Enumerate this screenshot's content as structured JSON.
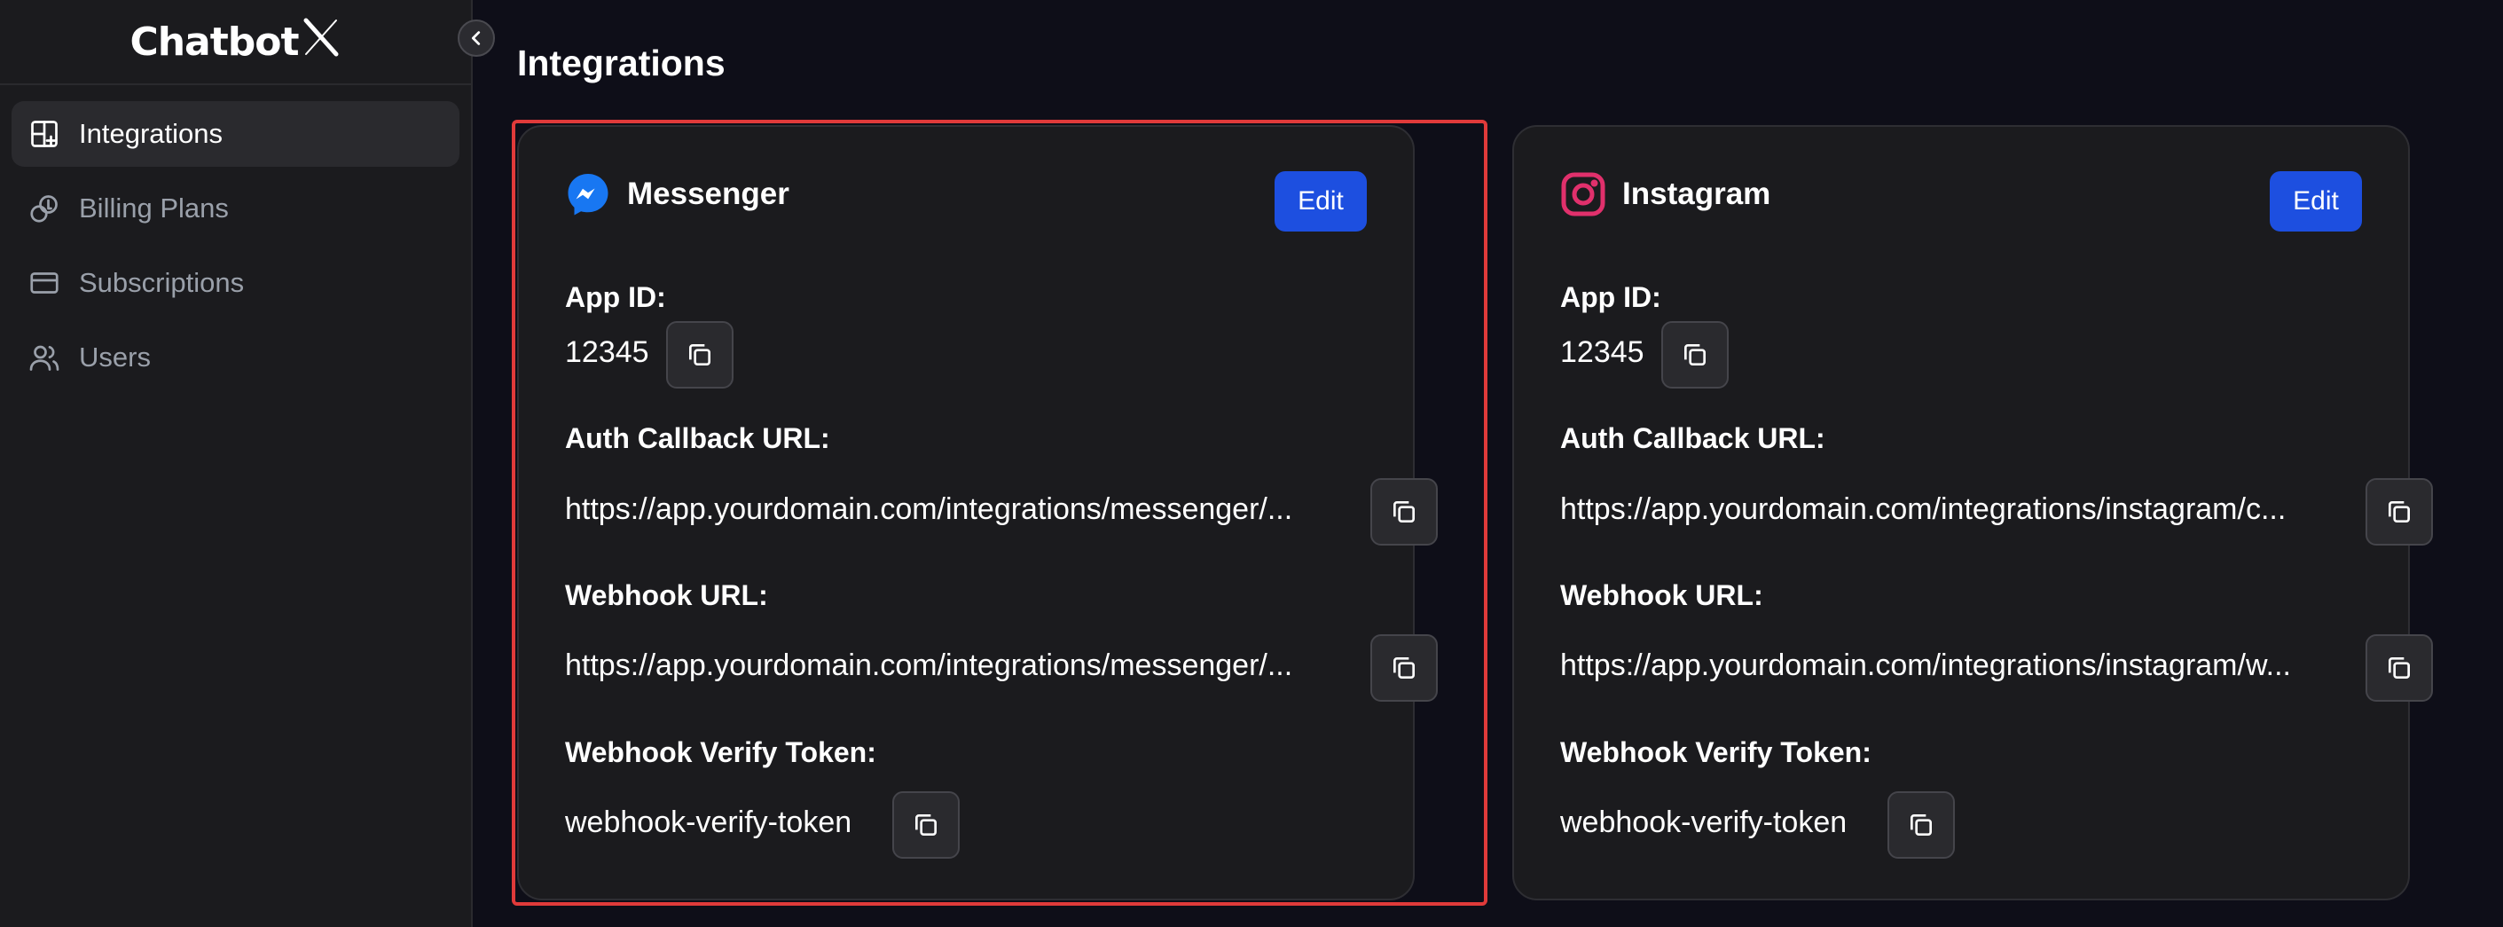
{
  "app": {
    "logo_text": "Chatbot",
    "logo_mark": "X"
  },
  "sidebar": {
    "items": [
      {
        "label": "Integrations",
        "icon": "integrations-grid-icon",
        "active": true
      },
      {
        "label": "Billing Plans",
        "icon": "billing-coins-icon",
        "active": false
      },
      {
        "label": "Subscriptions",
        "icon": "credit-card-icon",
        "active": false
      },
      {
        "label": "Users",
        "icon": "users-icon",
        "active": false
      }
    ]
  },
  "main": {
    "title": "Integrations"
  },
  "cards": {
    "messenger": {
      "name": "Messenger",
      "icon": "messenger-icon",
      "edit_label": "Edit",
      "app_id_label": "App ID:",
      "app_id": "12345",
      "auth_callback_label": "Auth Callback URL:",
      "auth_callback_url": "https://app.yourdomain.com/integrations/messenger/...",
      "webhook_label": "Webhook URL:",
      "webhook_url": "https://app.yourdomain.com/integrations/messenger/...",
      "verify_token_label": "Webhook Verify Token:",
      "verify_token": "webhook-verify-token"
    },
    "instagram": {
      "name": "Instagram",
      "icon": "instagram-icon",
      "edit_label": "Edit",
      "app_id_label": "App ID:",
      "app_id": "12345",
      "auth_callback_label": "Auth Callback URL:",
      "auth_callback_url": "https://app.yourdomain.com/integrations/instagram/c...",
      "webhook_label": "Webhook URL:",
      "webhook_url": "https://app.yourdomain.com/integrations/instagram/w...",
      "verify_token_label": "Webhook Verify Token:",
      "verify_token": "webhook-verify-token"
    }
  },
  "colors": {
    "accent": "#1d4fe0",
    "highlight": "#e03a3a",
    "messenger": "#1877f2",
    "instagram": "#e1306c"
  }
}
